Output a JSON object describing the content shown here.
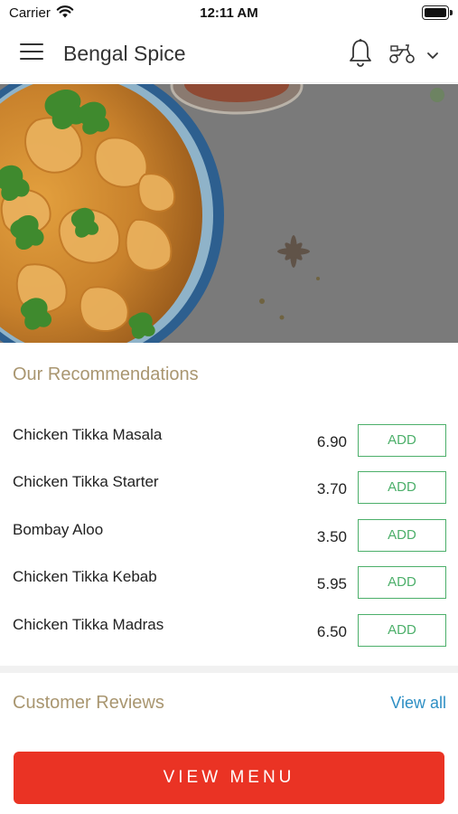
{
  "status_bar": {
    "carrier": "Carrier",
    "time": "12:11 AM"
  },
  "header": {
    "title": "Bengal Spice",
    "icons": [
      "menu-icon",
      "bell-icon",
      "scooter-icon",
      "chevron-down-icon"
    ]
  },
  "recommendations": {
    "title": "Our Recommendations",
    "items": [
      {
        "name": "Chicken Tikka Masala",
        "price": "6.90",
        "button": "ADD"
      },
      {
        "name": "Chicken Tikka Starter",
        "price": "3.70",
        "button": "ADD"
      },
      {
        "name": "Bombay Aloo",
        "price": "3.50",
        "button": "ADD"
      },
      {
        "name": "Chicken Tikka Kebab",
        "price": "5.95",
        "button": "ADD"
      },
      {
        "name": "Chicken Tikka Madras",
        "price": "6.50",
        "button": "ADD"
      }
    ]
  },
  "reviews": {
    "title": "Customer Reviews",
    "view_all": "View all"
  },
  "cta": {
    "label": "VIEW MENU"
  },
  "colors": {
    "accent_red": "#ea3324",
    "add_green": "#4caf6a",
    "section_title": "#a99670",
    "link_blue": "#2e8fc4"
  }
}
